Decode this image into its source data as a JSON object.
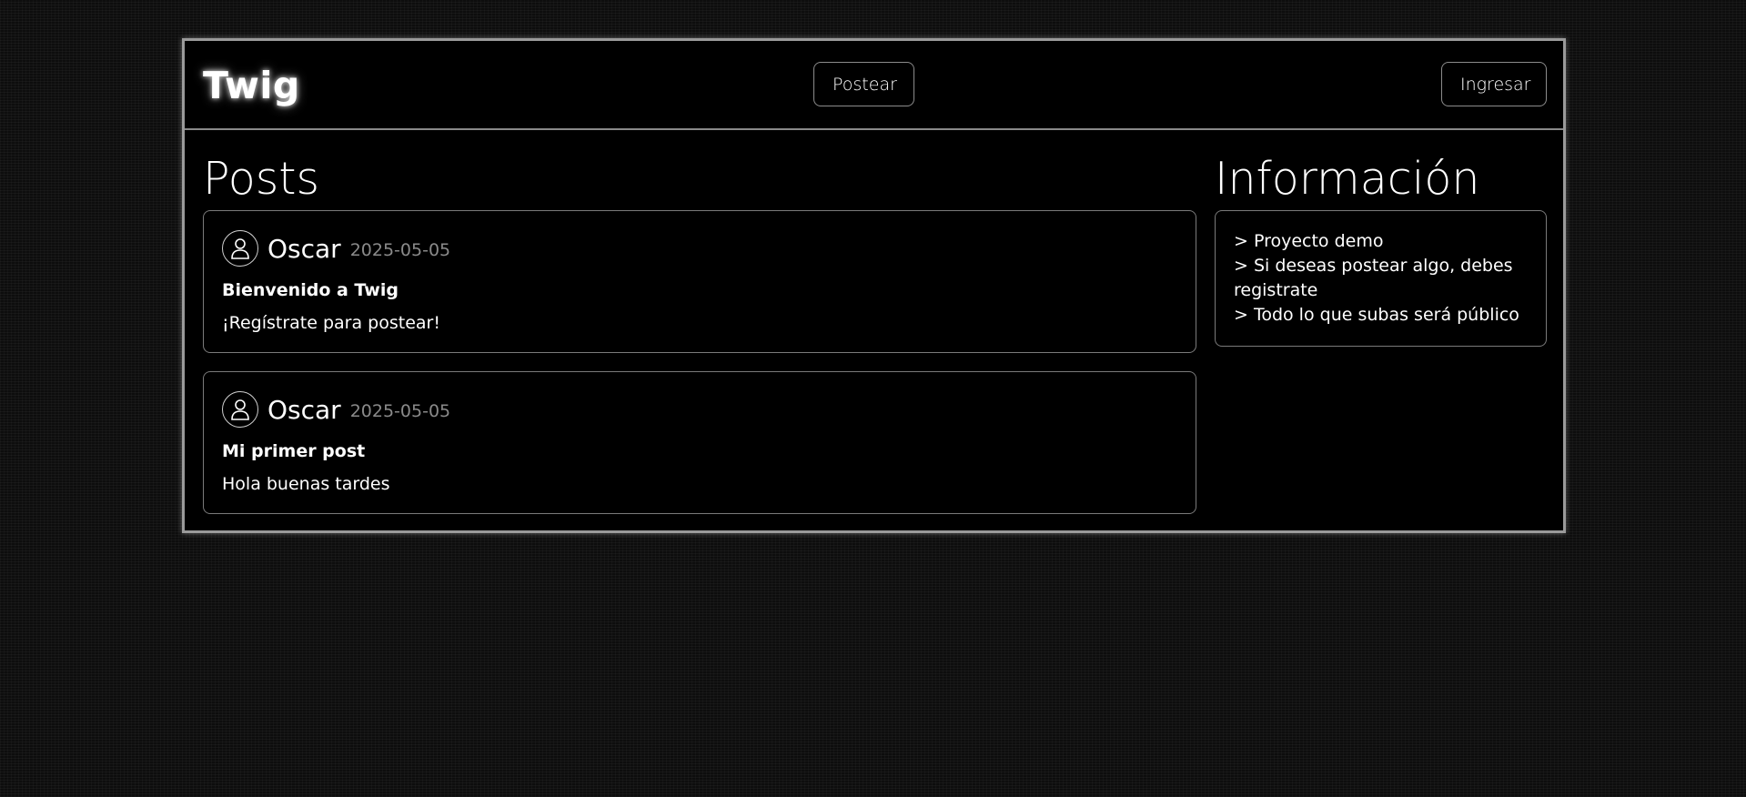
{
  "header": {
    "brand": "Twig",
    "post_button": "Postear",
    "login_button": "Ingresar"
  },
  "posts_section": {
    "title": "Posts",
    "posts": [
      {
        "author": "Oscar",
        "date": "2025-05-05",
        "title": "Bienvenido a Twig",
        "body": "¡Regístrate para postear!",
        "avatar_icon": "user-icon"
      },
      {
        "author": "Oscar",
        "date": "2025-05-05",
        "title": "Mi primer post",
        "body": "Hola buenas tardes",
        "avatar_icon": "user-icon"
      }
    ]
  },
  "info_section": {
    "title": "Información",
    "lines": [
      "> Proyecto demo",
      "> Si deseas postear algo, debes registrate",
      "> Todo lo que subas será público"
    ]
  },
  "colors": {
    "background": "#0d0d0d",
    "panel": "#000000",
    "border": "#7a7a7a",
    "muted_text": "#8a8a8a"
  }
}
